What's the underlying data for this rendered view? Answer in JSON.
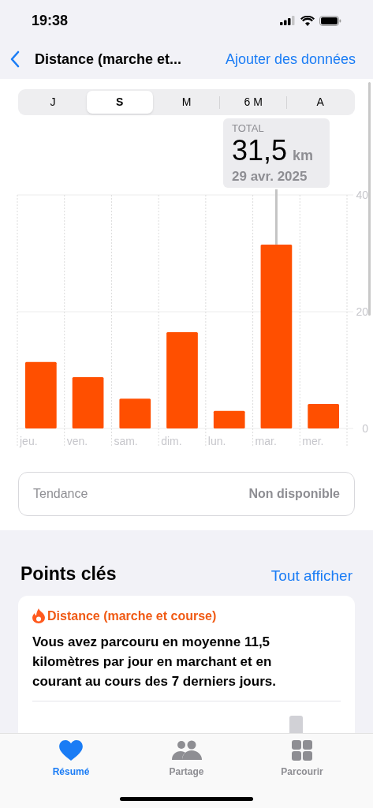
{
  "status_bar": {
    "time": "19:38"
  },
  "nav": {
    "title": "Distance (marche et...",
    "action": "Ajouter des données"
  },
  "segments": [
    {
      "label": "J",
      "selected": false
    },
    {
      "label": "S",
      "selected": true
    },
    {
      "label": "M",
      "selected": false
    },
    {
      "label": "6 M",
      "selected": false
    },
    {
      "label": "A",
      "selected": false
    }
  ],
  "chart": {
    "chart_data": {
      "type": "bar",
      "categories": [
        "jeu.",
        "ven.",
        "sam.",
        "dim.",
        "lun.",
        "mar.",
        "mer."
      ],
      "series": [
        {
          "color": "#ff4f00",
          "values": [
            11.4,
            8.8,
            5.1,
            16.5,
            3.0,
            31.5,
            4.2
          ]
        }
      ],
      "ylim": [
        0,
        40
      ],
      "yticks": [
        0,
        20,
        40
      ]
    },
    "tooltip": {
      "label": "TOTAL",
      "value": "31,5",
      "unit": "km",
      "date": "29 avr. 2025"
    }
  },
  "trend": {
    "label": "Tendance",
    "value": "Non disponible"
  },
  "highlights": {
    "title": "Points clés",
    "action": "Tout afficher",
    "card": {
      "category": "Distance (marche et course)",
      "text": "Vous avez parcouru en moyenne 11,5 kilomètres par jour en marchant et en courant au cours des 7 derniers jours."
    }
  },
  "tab_bar": [
    {
      "label": "Résumé",
      "kind": "heart",
      "selected": true
    },
    {
      "label": "Partage",
      "kind": "people",
      "selected": false
    },
    {
      "label": "Parcourir",
      "kind": "grid",
      "selected": false
    }
  ]
}
